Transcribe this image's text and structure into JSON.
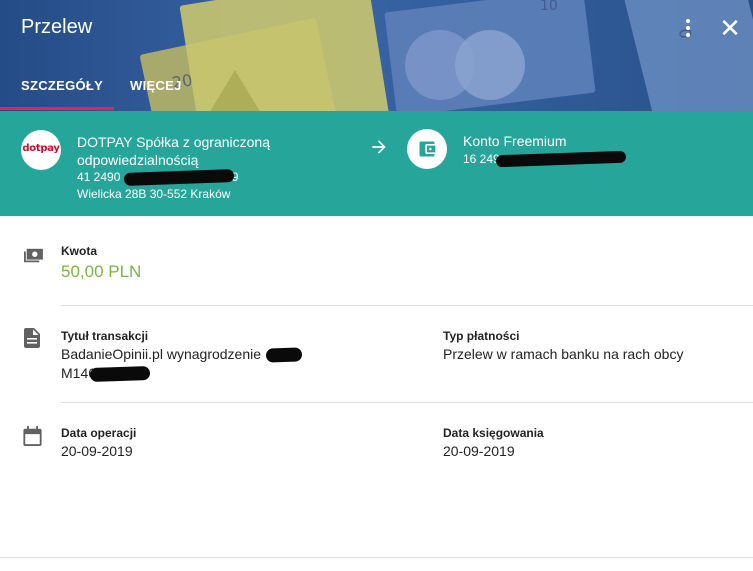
{
  "header": {
    "title": "Przelew",
    "tabs": [
      {
        "label": "SZCZEGÓŁY",
        "active": true
      },
      {
        "label": "WIĘCEJ",
        "active": false
      }
    ],
    "banknote_digits": [
      "20",
      "0",
      "10"
    ],
    "accent_color": "#e91e63"
  },
  "transfer": {
    "band_color": "#26a69a",
    "from": {
      "logo_text": "dotpay",
      "name": "DOTPAY Spółka z ograniczoną odpowiedzialnością",
      "account": "41 2490 ···· ···· ···· 7885 4189",
      "address": "Wielicka 28B 30-552 Kraków"
    },
    "to": {
      "name": "Konto Freemium",
      "account": "16 249···· ···· ···· ···· 0308"
    }
  },
  "details": {
    "amount_label": "Kwota",
    "amount_value": "50,00 PLN",
    "amount_color": "#7cb342",
    "title_label": "Tytuł transakcji",
    "title_value_line1": "BadanieOpinii.pl wynagrodzenie ····28",
    "title_value_line2": "M146······",
    "payment_type_label": "Typ płatności",
    "payment_type_value": "Przelew w ramach banku na rach obcy",
    "operation_date_label": "Data operacji",
    "operation_date_value": "20-09-2019",
    "posting_date_label": "Data księgowania",
    "posting_date_value": "20-09-2019"
  }
}
